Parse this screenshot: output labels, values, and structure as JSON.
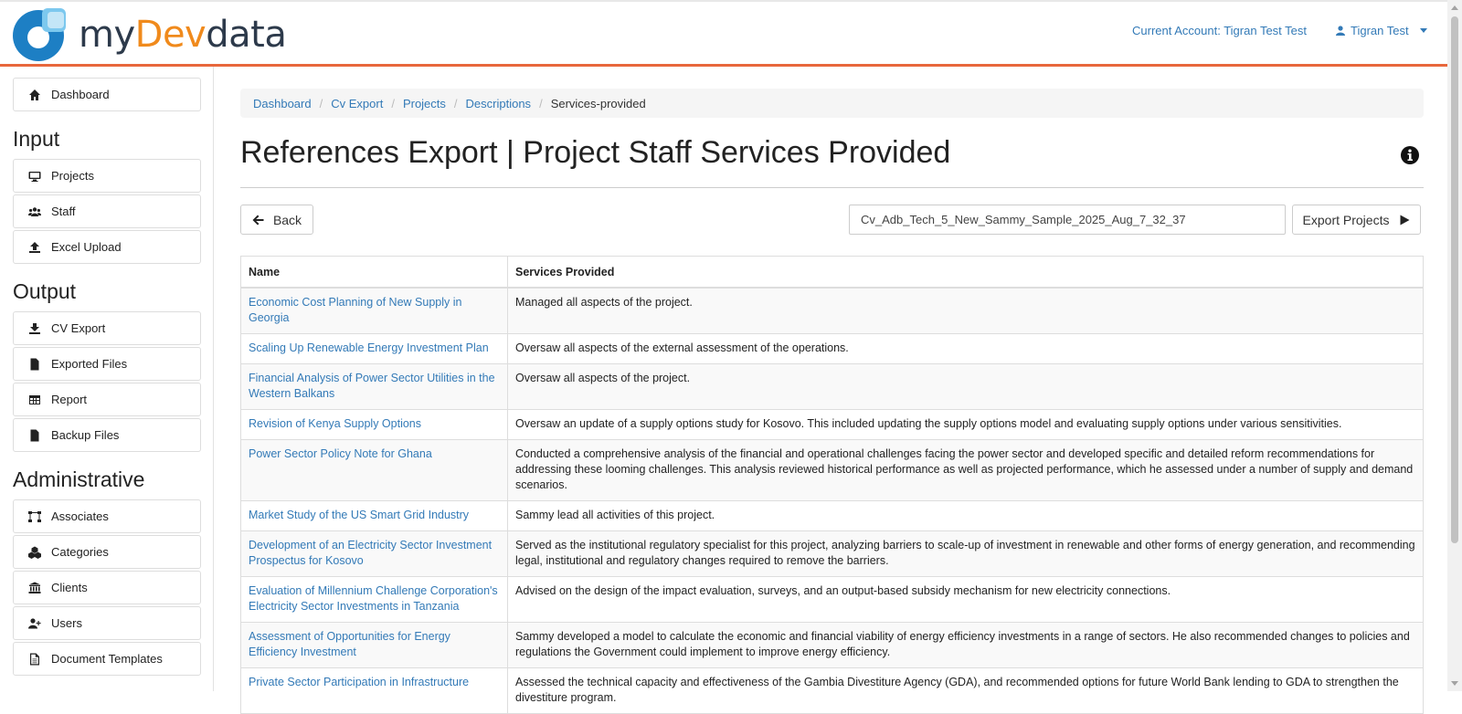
{
  "header": {
    "logo_part1": "my",
    "logo_part2": "Dev",
    "logo_part3": "data",
    "current_account": "Current Account: Tigran Test Test",
    "user_name": "Tigran Test"
  },
  "sidebar": {
    "dashboard": "Dashboard",
    "input_title": "Input",
    "input_items": [
      "Projects",
      "Staff",
      "Excel Upload"
    ],
    "output_title": "Output",
    "output_items": [
      "CV Export",
      "Exported Files",
      "Report",
      "Backup Files"
    ],
    "admin_title": "Administrative",
    "admin_items": [
      "Associates",
      "Categories",
      "Clients",
      "Users",
      "Document Templates"
    ]
  },
  "breadcrumb": [
    "Dashboard",
    "Cv Export",
    "Projects",
    "Descriptions",
    "Services-provided"
  ],
  "page_title": "References Export | Project Staff Services Provided",
  "toolbar": {
    "back_label": "Back",
    "filename_value": "Cv_Adb_Tech_5_New_Sammy_Sample_2025_Aug_7_32_37",
    "export_label": "Export Projects"
  },
  "table": {
    "headers": [
      "Name",
      "Services Provided"
    ],
    "rows": [
      {
        "name": "Economic Cost Planning of New Supply in Georgia",
        "services": "Managed all aspects of the project."
      },
      {
        "name": "Scaling Up Renewable Energy Investment Plan",
        "services": "Oversaw all aspects of the external assessment of the operations."
      },
      {
        "name": "Financial Analysis of Power Sector Utilities in the Western Balkans",
        "services": "Oversaw all aspects of the project."
      },
      {
        "name": "Revision of Kenya Supply Options",
        "services": "Oversaw an update of a supply options study for Kosovo. This included updating the supply options model and evaluating supply options under various sensitivities."
      },
      {
        "name": "Power Sector Policy Note for Ghana",
        "services": "Conducted a comprehensive analysis of the financial and operational challenges facing the power sector and developed specific and detailed reform recommendations for addressing these looming challenges. This analysis reviewed historical performance as well as projected performance, which he assessed under a number of supply and demand scenarios."
      },
      {
        "name": "Market Study of the US Smart Grid Industry",
        "services": "Sammy lead all activities of this project."
      },
      {
        "name": "Development of an Electricity Sector Investment Prospectus for Kosovo",
        "services": "Served as the institutional regulatory specialist for this project, analyzing barriers to scale-up of investment in renewable and other forms of energy generation, and recommending legal, institutional and regulatory changes required to remove the barriers."
      },
      {
        "name": "Evaluation of Millennium Challenge Corporation's Electricity Sector Investments in Tanzania",
        "services": "Advised on the design of the impact evaluation, surveys, and an output-based subsidy mechanism for new electricity connections."
      },
      {
        "name": "Assessment of Opportunities for Energy Efficiency Investment",
        "services": "Sammy developed a model to calculate the economic and financial viability of energy efficiency investments in a range of sectors. He also recommended changes to policies and regulations the Government could implement to improve energy efficiency."
      },
      {
        "name": "Private Sector Participation in Infrastructure",
        "services": "Assessed the technical capacity and effectiveness of the Gambia Divestiture Agency (GDA), and recommended options for future World Bank lending to GDA to strengthen the divestiture program."
      }
    ]
  },
  "colors": {
    "accent_orange": "#e8673c",
    "link_blue": "#337ab7",
    "logo_blue": "#1d7fc4"
  }
}
